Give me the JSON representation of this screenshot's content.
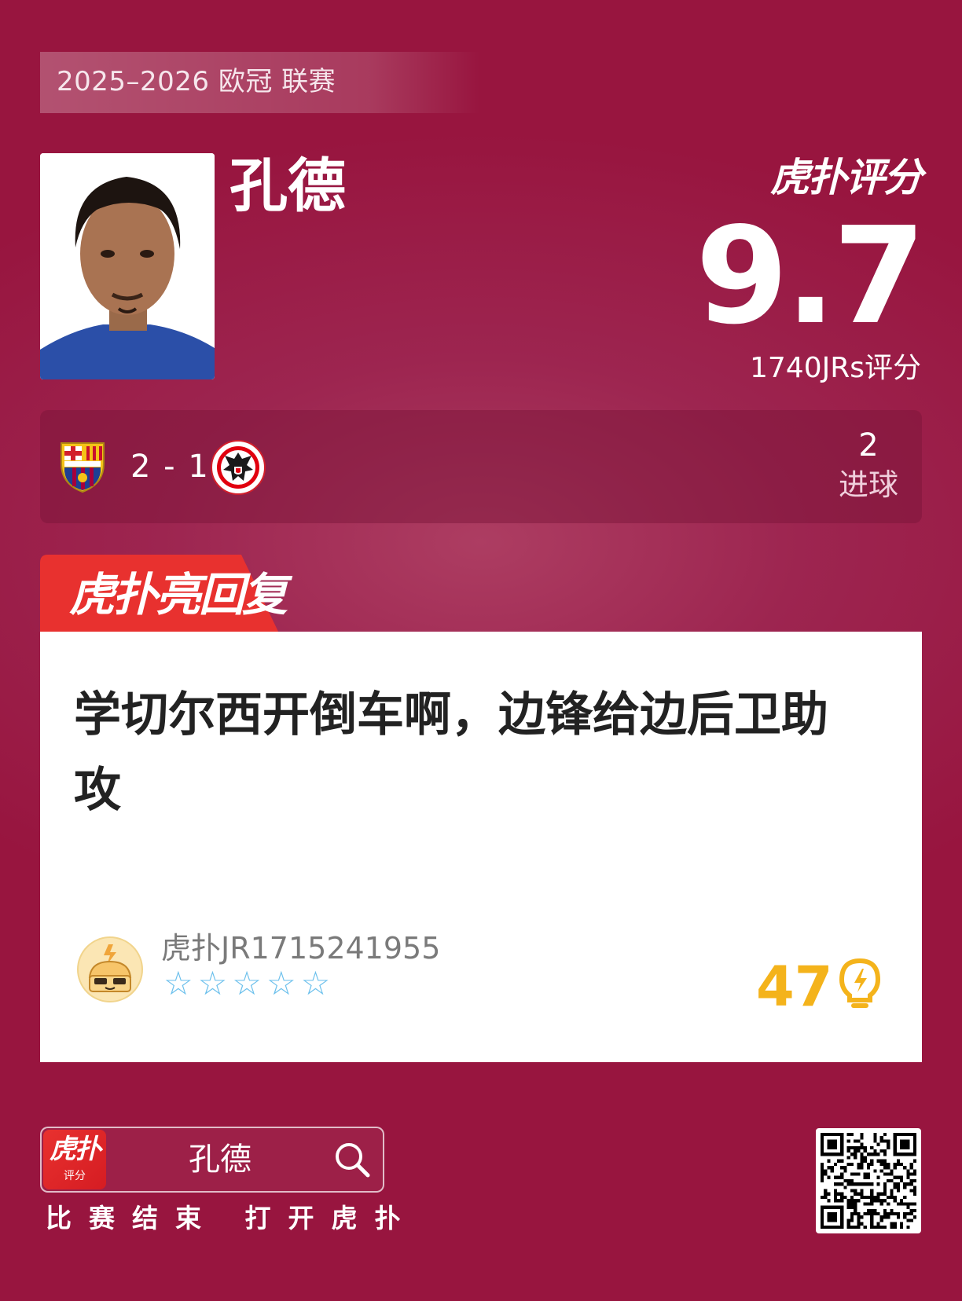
{
  "header": {
    "league": "2025–2026 欧冠 联赛"
  },
  "player": {
    "name": "孔德"
  },
  "rating": {
    "brand": "虎扑评分",
    "score": "9.7",
    "count": "1740JRs评分"
  },
  "match": {
    "score": "2 - 1",
    "home_crest": "fc-barcelona-crest",
    "away_crest": "eintracht-frankfurt-crest",
    "stat_value": "2",
    "stat_label": "进球"
  },
  "highlight": {
    "tab_label": "虎扑亮回复",
    "comment": "学切尔西开倒车啊，边锋给边后卫助攻",
    "user_name": "虎扑JR1715241955",
    "stars": "☆☆☆☆☆",
    "likes": "47"
  },
  "footer": {
    "app_logo_top": "虎扑",
    "app_logo_sub": "评分",
    "search_query": "孔德",
    "caption": "比赛结束 打开虎扑"
  },
  "colors": {
    "background": "#9d2550",
    "accent_red": "#e8312f",
    "likes": "#f4b31b",
    "stars": "#6cc0ec"
  }
}
